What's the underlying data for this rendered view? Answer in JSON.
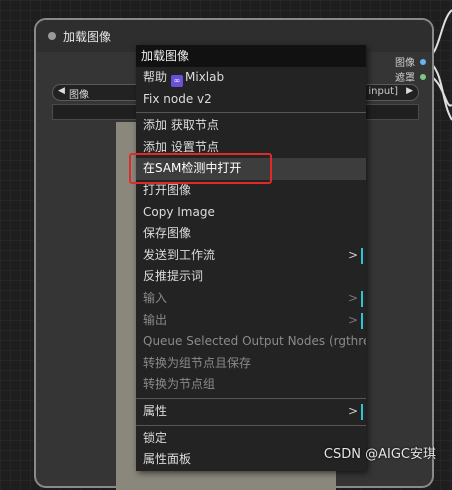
{
  "node": {
    "title": "加载图像",
    "outputs": [
      {
        "label": "图像",
        "color": "#64b5f6"
      },
      {
        "label": "遮罩",
        "color": "#81c784"
      }
    ],
    "widget": {
      "label": "图像",
      "value": "input]"
    }
  },
  "menu": {
    "title": "加载图像",
    "items": [
      {
        "label": "帮助",
        "suffix": "Mixlab",
        "icon": "mixlab-icon",
        "sep_after": false
      },
      {
        "label": "Fix node v2",
        "sep_after": true
      },
      {
        "label": "添加 获取节点"
      },
      {
        "label": "添加 设置节点"
      },
      {
        "label": "在SAM检测中打开",
        "highlight": true
      },
      {
        "label": "打开图像"
      },
      {
        "label": "Copy Image"
      },
      {
        "label": "保存图像"
      },
      {
        "label": "发送到工作流",
        "submenu": true
      },
      {
        "label": "反推提示词"
      },
      {
        "label": "输入",
        "disabled": true,
        "submenu": true
      },
      {
        "label": "输出",
        "disabled": true,
        "submenu": true
      },
      {
        "label": "Queue Selected Output Nodes (rgthree)",
        "disabled": true
      },
      {
        "label": "转换为组节点且保存",
        "disabled": true
      },
      {
        "label": "转换为节点组",
        "disabled": true,
        "sep_after": true
      },
      {
        "label": "属性",
        "submenu": true,
        "sep_after": true
      },
      {
        "label": "锁定"
      },
      {
        "label": "属性面板"
      }
    ]
  },
  "watermark": "CSDN @AIGC安琪"
}
